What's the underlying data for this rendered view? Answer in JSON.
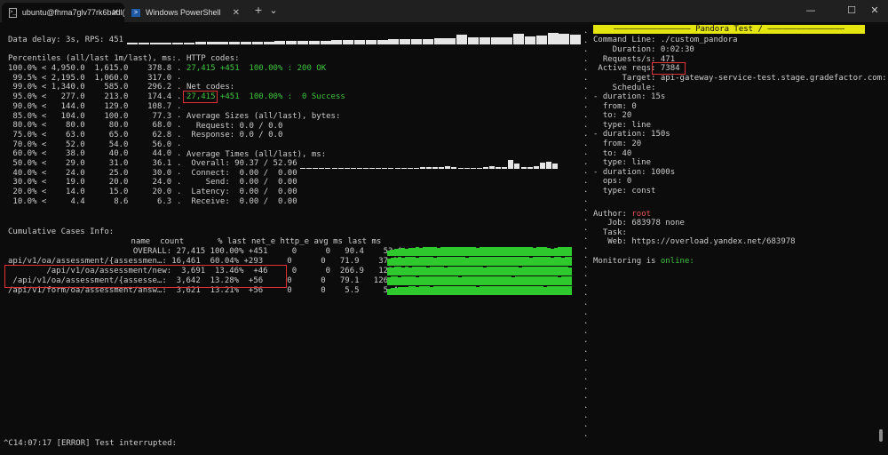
{
  "window": {
    "tabs": [
      {
        "label": "ubuntu@fhma7glv77rk6badl(",
        "close": "✕"
      },
      {
        "label": "Windows PowerShell",
        "close": "✕"
      }
    ],
    "new_tab": "+",
    "dropdown": "⌄",
    "minimize": "—",
    "maximize": "☐",
    "close": "✕"
  },
  "left": {
    "data_delay": "Data delay: 3s, RPS: 451",
    "percentiles_header": "Percentiles (all/last 1m/last), ms:",
    "percentiles": [
      "100.0% < 4,950.0  1,615.0    378.8",
      " 99.5% < 2,195.0  1,060.0    317.0",
      " 99.0% < 1,340.0    585.0    296.2",
      " 95.0% <   277.0    213.0    174.4",
      " 90.0% <   144.0    129.0    108.7",
      " 85.0% <   104.0    100.0     77.3",
      " 80.0% <    80.0     80.0     68.0",
      " 75.0% <    63.0     65.0     62.8",
      " 70.0% <    52.0     54.0     56.0",
      " 60.0% <    38.0     40.0     44.0",
      " 50.0% <    29.0     31.0     36.1",
      " 40.0% <    24.0     25.0     30.0",
      " 30.0% <    19.0     20.0     24.0",
      " 20.0% <    14.0     15.0     20.0",
      " 10.0% <     4.4      8.6      6.3"
    ],
    "http_header": "HTTP codes:",
    "http_count": "27,415",
    "http_rest": " +451  100.00% : 200 OK",
    "net_header": "Net codes:",
    "net_count": "27,415",
    "net_rest": " +451  100.00% :  0 Success",
    "sizes_header": "Average Sizes (all/last), bytes:",
    "sizes": [
      "  Request: 0.0 / 0.0",
      " Response: 0.0 / 0.0"
    ],
    "times_header": "Average Times (all/last), ms:",
    "times": [
      " Overall: 90.37 / 52.96",
      " Connect:  0.00 /  0.00",
      "    Send:  0.00 /  0.00",
      " Latency:  0.00 /  0.00",
      " Receive:  0.00 /  0.00"
    ],
    "cases_header": "Cumulative Cases Info:",
    "cases_cols": "                              name  count       % last net_e http_e avg ms last ms",
    "cases": [
      "                          OVERALL: 27,415 100.00% +451     0      0   90.4    53.0",
      "api/v1/oa/assessment/{assessmen…: 16,461  60.04% +293     0      0   71.9    37.1",
      "        /api/v1/oa/assessment/new:  3,691  13.46%  +46     0      0  266.9   122.1",
      " /api/v1/oa/assessment/{assesse…:  3,642  13.28%  +56     0      0   79.1   126.8",
      "/api/v1/form/oa/assessment/answ…:  3,621  13.21%  +56     0      0    5.5     5.4"
    ],
    "error_line": "^C14:07:17 [ERROR] Test interrupted:"
  },
  "right": {
    "banner": "———————————————— Pandora Test / ————————————————",
    "command_line": "Command Line: ./custom_pandora",
    "duration": "    Duration: 0:02:30",
    "requests": "  Requests/s: 471",
    "active_label": " Active reqs: ",
    "active_value": "7384",
    "target": "      Target: api-gateway-service-test.stage.gradefactor.com:",
    "schedule": "    Schedule:",
    "sched_lines": [
      "- duration: 15s",
      "  from: 0",
      "  to: 20",
      "  type: line",
      "- duration: 150s",
      "  from: 20",
      "  to: 40",
      "  type: line",
      "- duration: 1000s",
      "  ops: 0",
      "  type: const"
    ],
    "author_label": "Author: ",
    "author_value": "root",
    "job": "   Job: 683978 none",
    "task": "  Task:",
    "web": "   Web: https://overload.yandex.net/683978",
    "monitoring_label": "Monitoring is ",
    "monitoring_value": "online:",
    "gutter_dot": "."
  }
}
